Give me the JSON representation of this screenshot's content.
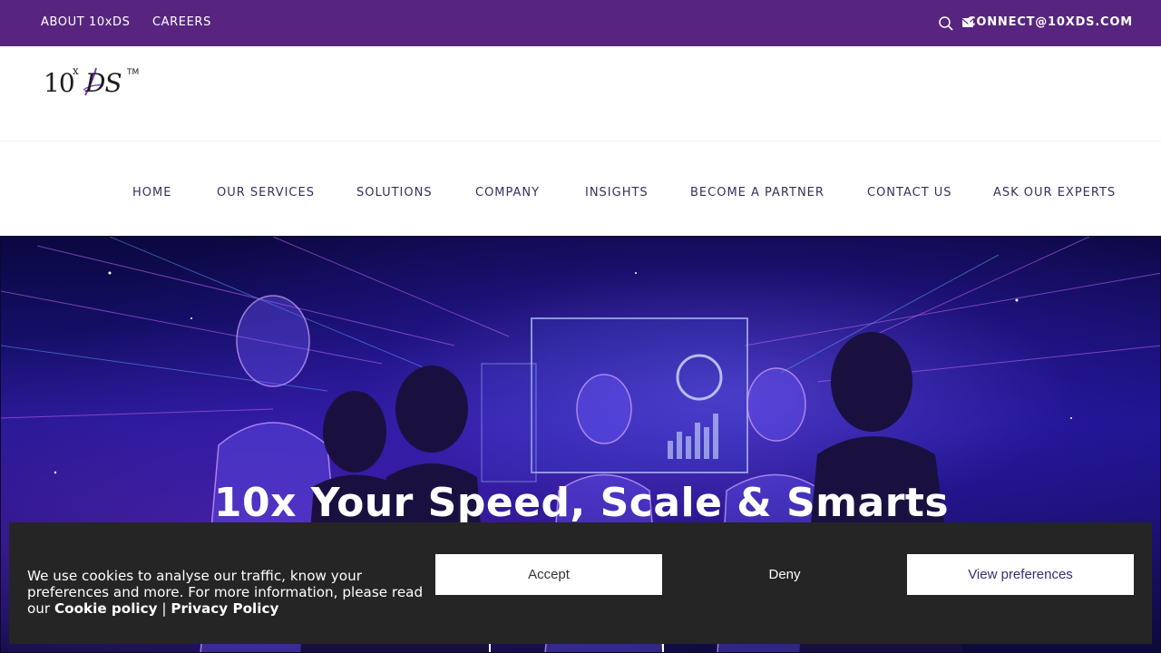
{
  "topbar": {
    "about_label": "ABOUT 10xDS",
    "careers_label": "CAREERS",
    "email_label": "CONNECT@10XDS.COM",
    "icons": [
      "search-icon",
      "mail-icon"
    ],
    "background": "#572580"
  },
  "logo": {
    "ten": "10",
    "x": "x",
    "ds": "DS",
    "tm": "TM"
  },
  "nav": {
    "items": [
      {
        "label": "HOME"
      },
      {
        "label": "OUR SERVICES"
      },
      {
        "label": "SOLUTIONS"
      },
      {
        "label": "COMPANY"
      },
      {
        "label": "INSIGHTS"
      },
      {
        "label": "BECOME A PARTNER"
      },
      {
        "label": "CONTACT US"
      },
      {
        "label": "ASK OUR EXPERTS"
      }
    ]
  },
  "hero": {
    "headline": "10x Your Speed, Scale & Smarts"
  },
  "cookie": {
    "message": "We use cookies to analyse our traffic, know your preferences and more. For more information, please read our ",
    "cookie_policy_label": "Cookie policy",
    "separator": " | ",
    "privacy_policy_label": "Privacy Policy",
    "accept_label": "Accept",
    "deny_label": "Deny",
    "preferences_label": "View preferences"
  }
}
